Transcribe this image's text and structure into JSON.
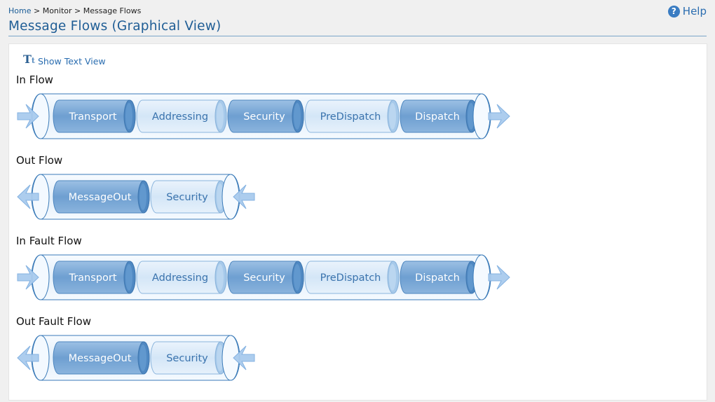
{
  "breadcrumb": {
    "home": "Home",
    "sep1": " > ",
    "monitor": "Monitor",
    "sep2": " > ",
    "current": "Message Flows"
  },
  "help": {
    "label": "Help",
    "icon": "question-circle-icon",
    "glyph": "?"
  },
  "page_title": "Message Flows (Graphical View)",
  "text_view_link": {
    "label": "Show Text View",
    "icon": "text-view-icon",
    "glyph": "T",
    "glyph_small": "t"
  },
  "colors": {
    "dark_phase": "#6e9fd1",
    "light_phase": "#d4e6f7",
    "pipe_outline": "#3a7ab8",
    "arrow": "#a9cbee",
    "title": "#1f5d95"
  },
  "flows": [
    {
      "id": "in-flow",
      "title": "In Flow",
      "direction": "in",
      "phases": [
        "Transport",
        "Addressing",
        "Security",
        "PreDispatch",
        "Dispatch"
      ]
    },
    {
      "id": "out-flow",
      "title": "Out Flow",
      "direction": "out",
      "phases": [
        "MessageOut",
        "Security"
      ]
    },
    {
      "id": "in-fault-flow",
      "title": "In Fault Flow",
      "direction": "in",
      "phases": [
        "Transport",
        "Addressing",
        "Security",
        "PreDispatch",
        "Dispatch"
      ]
    },
    {
      "id": "out-fault-flow",
      "title": "Out Fault Flow",
      "direction": "out",
      "phases": [
        "MessageOut",
        "Security"
      ]
    }
  ]
}
